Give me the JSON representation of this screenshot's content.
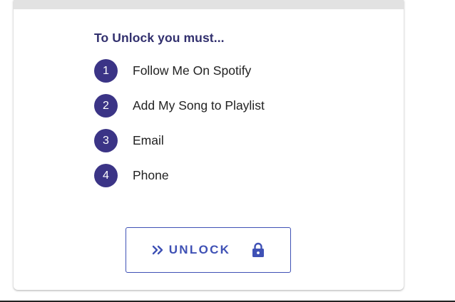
{
  "unlock_card": {
    "heading": "To Unlock you must...",
    "steps": [
      {
        "number": "1",
        "label": "Follow Me On Spotify"
      },
      {
        "number": "2",
        "label": "Add My Song to Playlist"
      },
      {
        "number": "3",
        "label": "Email"
      },
      {
        "number": "4",
        "label": "Phone"
      }
    ],
    "unlock_button": {
      "label": "UNLOCK",
      "leading_icon": "double-chevron-right-icon",
      "trailing_icon": "lock-icon"
    }
  },
  "colors": {
    "heading": "#32306e",
    "step_badge": "#3b3486",
    "button_accent": "#3f51b5",
    "topbar": "#e2e2e2"
  }
}
